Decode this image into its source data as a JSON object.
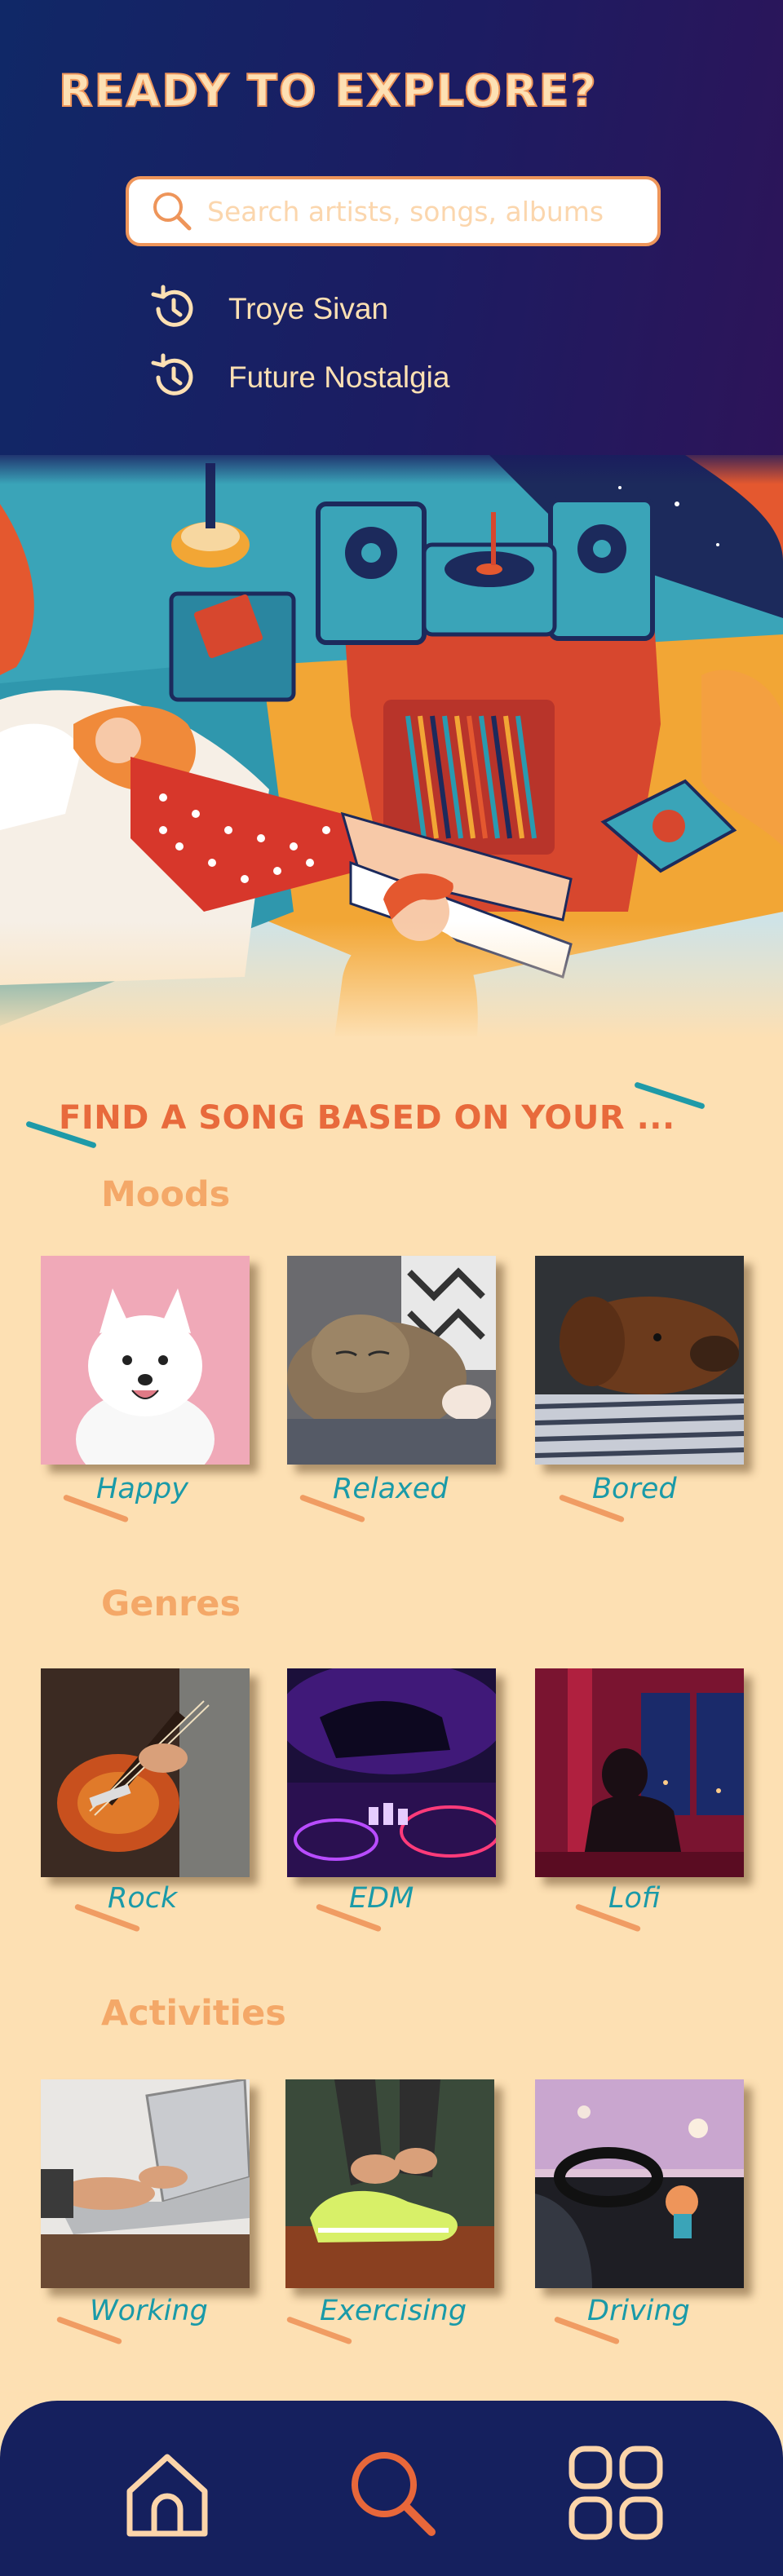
{
  "header": {
    "title": "READY TO EXPLORE?",
    "search": {
      "placeholder": "Search artists, songs, albums",
      "value": ""
    },
    "recent_searches": [
      "Troye Sivan",
      "Future Nostalgia"
    ]
  },
  "find": {
    "title": "FIND A SONG BASED ON YOUR ...",
    "sections": [
      {
        "label": "Moods",
        "items": [
          "Happy",
          "Relaxed",
          "Bored"
        ]
      },
      {
        "label": "Genres",
        "items": [
          "Rock",
          "EDM",
          "Lofi"
        ]
      },
      {
        "label": "Activities",
        "items": [
          "Working",
          "Exercising",
          "Driving"
        ]
      }
    ]
  },
  "nav": {
    "items": [
      "home-icon",
      "search-icon",
      "grid-icon"
    ]
  },
  "colors": {
    "header_bg": "#1c1c62",
    "cream": "#fde0b3",
    "accent_orange": "#ee955a",
    "title_red": "#e86a3c",
    "teal": "#1a9aa8",
    "nav_bg": "#15205e"
  }
}
